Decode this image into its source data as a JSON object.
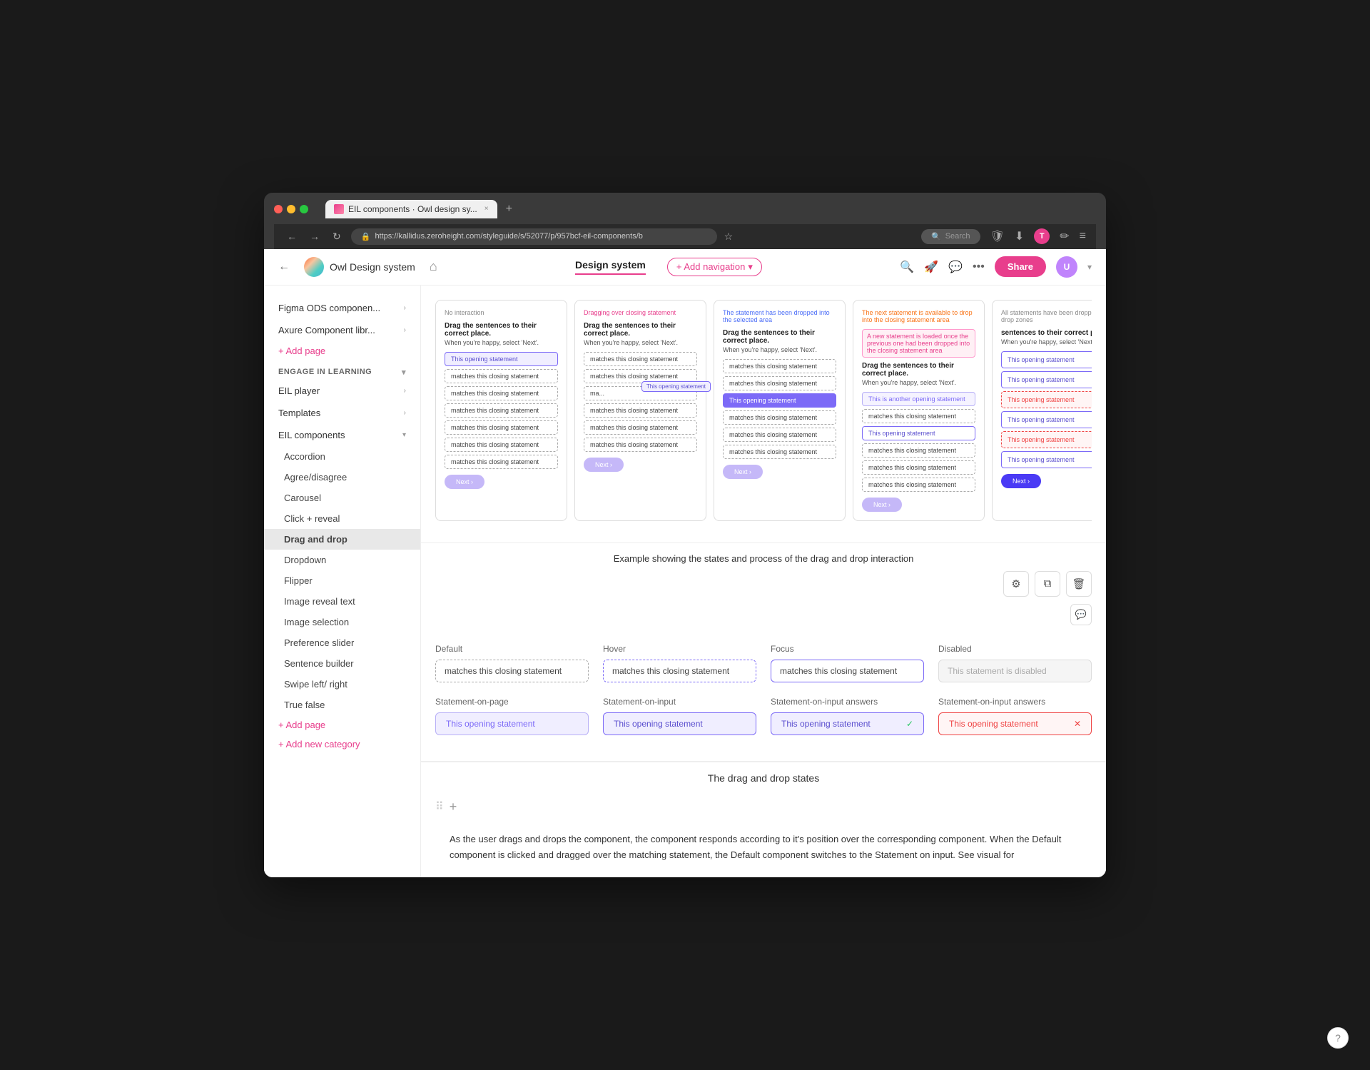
{
  "browser": {
    "tab_label": "EIL components · Owl design sy...",
    "tab_close": "×",
    "new_tab": "+",
    "nav_back": "←",
    "nav_forward": "→",
    "nav_refresh": "↻",
    "address": "https://kallidus.zeroheight.com/styleguide/s/52077/p/957bcf-eil-components/b",
    "bookmark_icon": "☆",
    "search_placeholder": "Search",
    "shield_icon": "🛡",
    "download_icon": "⬇",
    "profile_icon": "T",
    "pen_icon": "✏",
    "menu_icon": "≡"
  },
  "navbar": {
    "back_label": "←",
    "brand_name": "Owl Design system",
    "home_icon": "⌂",
    "nav_design_system": "Design system",
    "nav_add_navigation": "+ Add navigation",
    "nav_chevron": "▾",
    "search_icon": "🔍",
    "rocket_icon": "🚀",
    "chat_icon": "💬",
    "more_icon": "•••",
    "share_btn": "Share",
    "user_initial": "U",
    "user_chevron": "▾"
  },
  "sidebar": {
    "figma_label": "Figma ODS componen...",
    "axure_label": "Axure Component libr...",
    "add_page_label": "+ Add page",
    "engage_section": "ENGAGE IN LEARNING",
    "eil_player": "EIL player",
    "templates": "Templates",
    "eil_components": "EIL components",
    "items": [
      "Accordion",
      "Agree/disagree",
      "Carousel",
      "Click + reveal",
      "Drag and drop",
      "Dropdown",
      "Flipper",
      "Image reveal text",
      "Image selection",
      "Preference slider",
      "Sentence builder",
      "Swipe left/ right",
      "True false"
    ],
    "add_page_bottom": "+ Add page",
    "add_category": "+ Add new category"
  },
  "demo": {
    "caption": "Example showing the states and process of the drag and drop interaction",
    "frames": [
      {
        "label": "No interaction",
        "title": "Drag the sentences to their correct place.",
        "subtitle": "When you're happy, select 'Next'.",
        "highlight": "This opening statement",
        "closing_statements": [
          "matches this closing statement",
          "matches this closing statement",
          "matches this closing statement",
          "matches this closing statement",
          "matches this closing statement",
          "matches this closing statement"
        ],
        "next_label": "Next ›"
      },
      {
        "label": "Dragging over closing statement",
        "title": "Drag the sentences to their correct place.",
        "subtitle": "When you're happy, select 'Next'.",
        "dragging_label": "This opening statement",
        "closing_statements": [
          "matches this closing statement",
          "matches this closing statement",
          "ma...",
          "matches this closing statement",
          "matches this closing statement",
          "matches this closing statement"
        ],
        "next_label": "Next ›"
      },
      {
        "label": "The statement has been dropped into the selected area",
        "title": "Drag the sentences to their correct place.",
        "subtitle": "When you're happy, select 'Next'.",
        "dropped_label": "This opening statement",
        "closing_statements": [
          "matches this closing statement",
          "matches this closing statement",
          "matches this closing statement",
          "matches this closing statement",
          "matches this closing statement"
        ],
        "next_label": "Next ›"
      },
      {
        "label": "The next statement is available to drop into the closing statement area",
        "annotation": "A new statement is loaded once the previous one had been dropped into the closing statement area",
        "title": "Drag the sentences to their correct place.",
        "subtitle": "When you're happy, select 'Next'.",
        "opening1": "This is another opening statement",
        "opening2": "This opening statement",
        "closing_statements": [
          "matches this closing statement",
          "matches this closing statement",
          "matches this closing statement",
          "matches this closing statement"
        ],
        "next_label": "Next ›"
      },
      {
        "label": "All statements have been dropped into drop zones",
        "title": "sentences to their correct place.",
        "subtitle": "When you're happy, select 'Next'.",
        "opening_statements": [
          {
            "text": "This opening statement",
            "correct": true
          },
          {
            "text": "This opening statement",
            "correct": true
          },
          {
            "text": "This opening statement",
            "correct": false
          },
          {
            "text": "This opening statement",
            "correct": true
          },
          {
            "text": "This opening statement",
            "correct": false
          },
          {
            "text": "This opening statement",
            "correct": true
          }
        ],
        "next_label": "Next ›",
        "next_dark": true
      }
    ]
  },
  "states": {
    "default_label": "Default",
    "default_text": "matches this closing statement",
    "hover_label": "Hover",
    "hover_text": "matches this closing statement",
    "focus_label": "Focus",
    "focus_text": "matches this closing statement",
    "disabled_label": "Disabled",
    "disabled_text": "This statement is disabled",
    "stmt_page_label": "Statement-on-page",
    "stmt_page_text": "This opening statement",
    "stmt_input_label": "Statement-on-input",
    "stmt_input_text": "This opening statement",
    "stmt_input_ans1_label": "Statement-on-input answers",
    "stmt_input_ans1_text": "This opening statement",
    "stmt_input_ans1_correct": true,
    "stmt_input_ans2_label": "Statement-on-input answers",
    "stmt_input_ans2_text": "This opening statement",
    "stmt_input_ans2_correct": false
  },
  "dnd_states": {
    "section_title": "The drag and drop states",
    "body_text": "As the user drags and drops the component, the component responds according to it's position over the corresponding component. When the Default component is clicked and dragged over the matching statement, the Default component switches to the Statement on input. See visual for"
  },
  "toolbar": {
    "settings_icon": "⚙",
    "copy_icon": "⧉",
    "delete_icon": "🗑",
    "comment_icon": "💬"
  },
  "help": {
    "icon": "?"
  }
}
